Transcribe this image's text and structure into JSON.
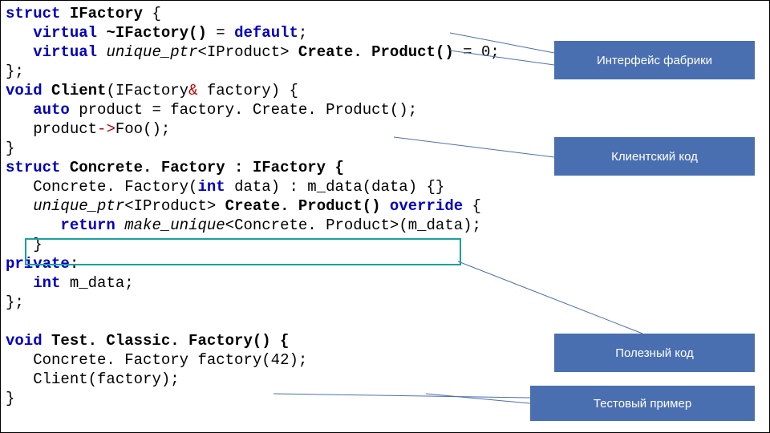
{
  "code": {
    "l1": {
      "kw1": "struct",
      "name": "IFactory",
      "open": " {"
    },
    "l2": {
      "pad": "   ",
      "kw1": "virtual",
      "fn": " ~IFactory()",
      "eq": " = ",
      "kw2": "default",
      "semi": ";"
    },
    "l3": {
      "pad": "   ",
      "kw1": "virtual",
      "sp": " ",
      "typ": "unique_ptr",
      "tpl": "<IProduct>",
      "fn": " Create. Product()",
      "eq": " = 0; "
    },
    "l4": {
      "txt": "}; "
    },
    "l5": {
      "kw1": "void",
      "fn": " Client",
      "args": "(IFactory",
      "amp": "& ",
      "rest": "factory) {"
    },
    "l6": {
      "pad": "   ",
      "kw1": "auto",
      "txt": " product = factory. Create. Product(); "
    },
    "l7": {
      "pad": "   ",
      "txt": "product",
      "arrow": "->",
      "call": "Foo(); "
    },
    "l8": {
      "txt": "}"
    },
    "l9": {
      "kw1": "struct",
      "name": " Concrete. Factory : IFactory {"
    },
    "l10": {
      "pad": "   ",
      "txt": "Concrete. Factory(",
      "kw1": "int",
      "rest": " data) : m_data(data) {}"
    },
    "l11": {
      "pad": "   ",
      "typ": "unique_ptr",
      "tpl": "<IProduct>",
      "fn": " Create. Product()",
      "kw1": " override",
      "open": " {"
    },
    "l12": {
      "pad": "      ",
      "kw1": "return",
      "sp": " ",
      "typ": "make_unique",
      "tpl": "<Concrete. Product>",
      "rest": "(m_data); "
    },
    "l13": {
      "pad": "   ",
      "txt": "}"
    },
    "l14": {
      "kw1": "private",
      "colon": ":"
    },
    "l15": {
      "pad": "   ",
      "kw1": "int",
      "txt": " m_data; "
    },
    "l16": {
      "txt": "}; "
    },
    "l17": {
      "txt": ""
    },
    "l18": {
      "kw1": "void",
      "fn": " Test. Classic. Factory() {"
    },
    "l19": {
      "pad": "   ",
      "txt": "Concrete. Factory factory(42); "
    },
    "l20": {
      "pad": "   ",
      "txt": "Client(factory); "
    },
    "l21": {
      "txt": "}"
    }
  },
  "labels": {
    "factory_interface": "Интерфейс фабрики",
    "client_code": "Клиентский код",
    "useful_code": "Полезный код",
    "test_example": "Тестовый пример"
  }
}
